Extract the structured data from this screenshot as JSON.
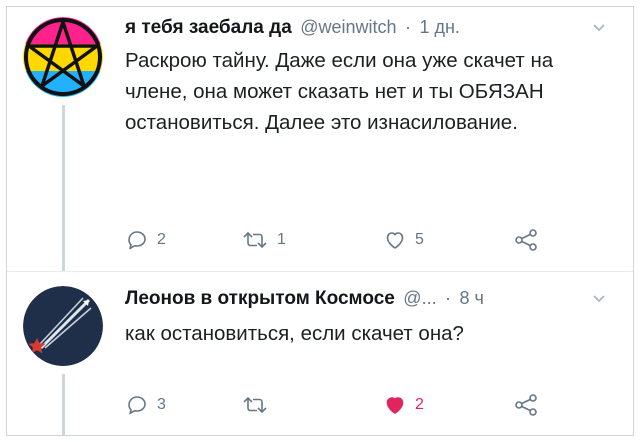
{
  "tweets": [
    {
      "display_name": "я тебя заебала да",
      "handle": "@weinwitch",
      "dot": "·",
      "time": "1 дн.",
      "text": "Раскрою тайну. Даже если она уже скачет на члене, она может сказать нет и ты ОБЯЗАН остановиться. Далее это изнасилование.",
      "replies": "2",
      "retweets": "1",
      "likes": "5",
      "liked": false,
      "avatar_icon": "pentagram-avatar-icon"
    },
    {
      "display_name": "Леонов в открытом Космосе",
      "handle": "@...",
      "dot": "·",
      "time": "8 ч",
      "text": "как остановиться, если скачет она?",
      "replies": "3",
      "retweets": "",
      "likes": "2",
      "liked": true,
      "avatar_icon": "rocket-star-avatar-icon"
    }
  ],
  "colors": {
    "text": "#1c2022",
    "muted": "#657786",
    "like_active": "#e0245e",
    "pan_pink": "#ff218c",
    "pan_yellow": "#ffd800",
    "pan_blue": "#21b1ff",
    "space_navy": "#1f2f4a"
  }
}
